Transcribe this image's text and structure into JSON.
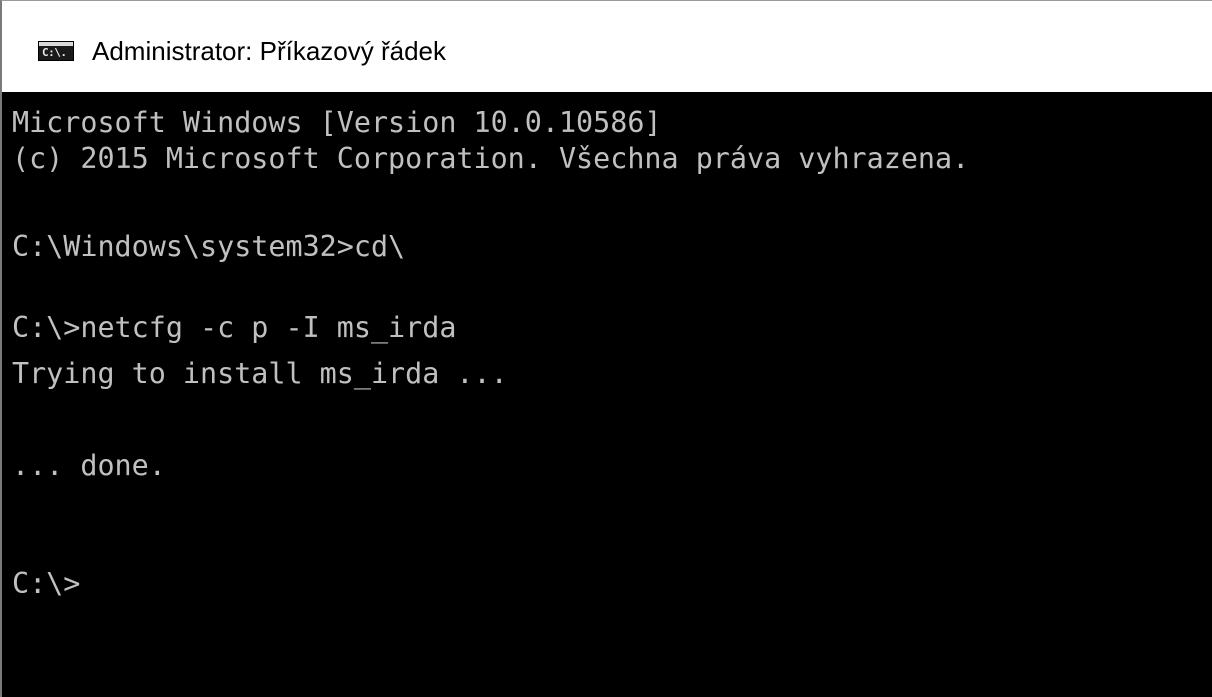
{
  "window": {
    "title": "Administrator: Příkazový řádek",
    "icon": "cmd-icon",
    "icon_text": "C:\\."
  },
  "console": {
    "lines": [
      "Microsoft Windows [Version 10.0.10586]",
      "(c) 2015 Microsoft Corporation. Všechna práva vyhrazena.",
      "",
      "C:\\Windows\\system32>cd\\",
      "",
      "C:\\>netcfg -c p -I ms_irda",
      "Trying to install ms_irda ...",
      "",
      "... done.",
      "",
      "",
      "C:\\>"
    ]
  },
  "colors": {
    "console_bg": "#000000",
    "console_fg": "#c0c0c0",
    "titlebar_bg": "#ffffff"
  }
}
